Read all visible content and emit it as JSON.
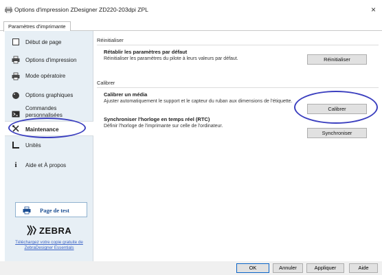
{
  "window": {
    "title": "Options d'impression ZDesigner ZD220-203dpi ZPL",
    "close_glyph": "×"
  },
  "tabs": [
    {
      "label": "Paramètres d'imprimante",
      "active": true
    }
  ],
  "sidebar": {
    "items": [
      {
        "label": "Début de page",
        "icon": "page-icon"
      },
      {
        "label": "Options d'impression",
        "icon": "printer-icon"
      },
      {
        "label": "Mode opératoire",
        "icon": "printer-mode-icon"
      },
      {
        "label": "Options graphiques",
        "icon": "palette-icon"
      },
      {
        "label_line1": "Commandes",
        "label_line2": "personnalisées",
        "icon": "terminal-icon"
      },
      {
        "label": "Maintenance",
        "icon": "tools-icon",
        "active": true
      },
      {
        "label": "Unités",
        "icon": "ruler-icon"
      },
      {
        "label": "Aide et À propos",
        "icon": "info-icon"
      }
    ],
    "test_page_label": "Page de test",
    "logo_text": "ZEBRA",
    "download_link": "Téléchargez votre copie gratuite de ZebraDesigner Essentials"
  },
  "main": {
    "reset_section": {
      "header": "Réinitialiser",
      "title": "Rétablir les paramètres par défaut",
      "description": "Réinitialiser les paramètres du pilote à leurs valeurs par défaut.",
      "button": "Réinitialiser"
    },
    "calibrate_section": {
      "header": "Calibrer",
      "media_title": "Calibrer un média",
      "media_description": "Ajuster automatiquement le support et le capteur du ruban aux dimensions de l'étiquette.",
      "calibrate_button": "Calibrer",
      "rtc_title": "Synchroniser l'horloge en temps réel (RTC)",
      "rtc_description": "Définir l'horloge de l'imprimante sur celle de l'ordinateur.",
      "sync_button": "Synchroniser"
    }
  },
  "footer": {
    "ok": "OK",
    "cancel": "Annuler",
    "apply": "Appliquer",
    "help": "Aide"
  },
  "colors": {
    "sidebar_bg": "#e7eff5",
    "highlight_circle": "#3b3fbf",
    "link": "#3b63c6",
    "test_page_text": "#1d4f93"
  }
}
